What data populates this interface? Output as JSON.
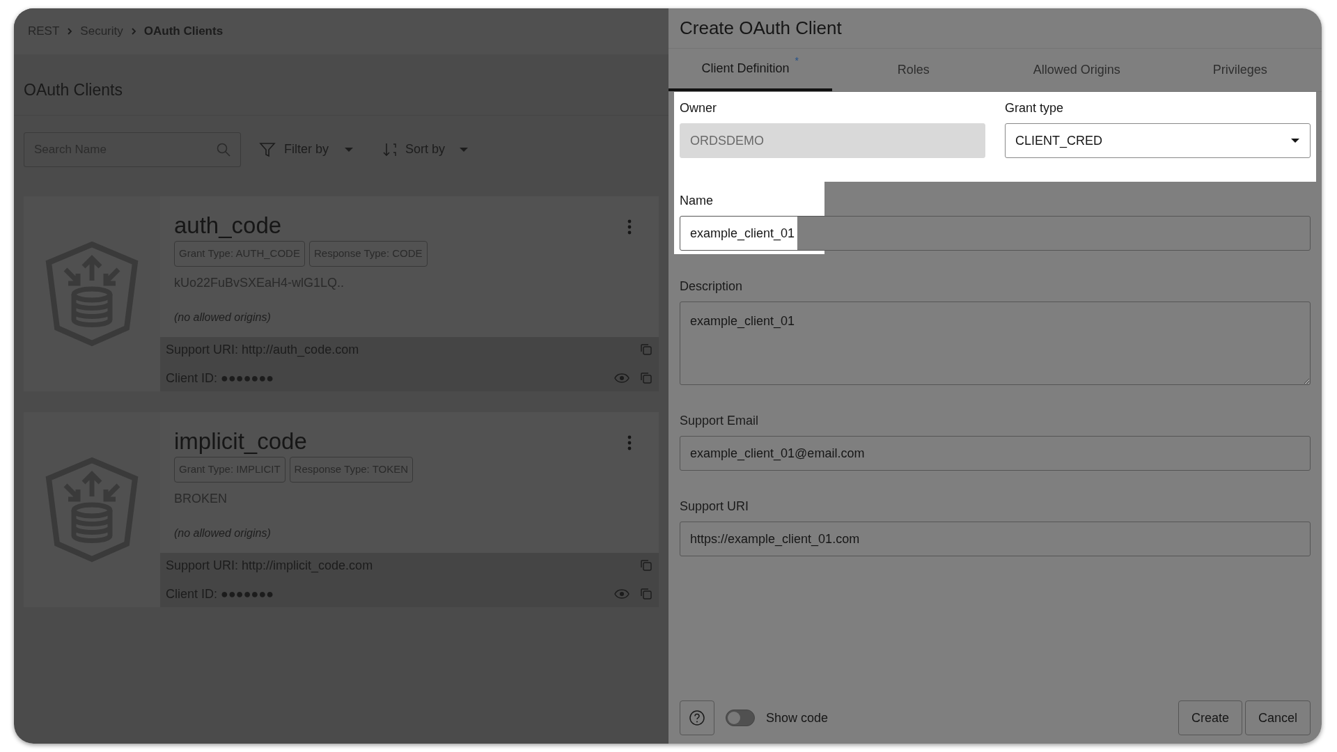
{
  "breadcrumb": [
    {
      "label": "REST",
      "current": false
    },
    {
      "label": "Security",
      "current": false
    },
    {
      "label": "OAuth Clients",
      "current": true
    }
  ],
  "list_panel": {
    "title": "OAuth Clients",
    "search": {
      "placeholder": "Search Name"
    },
    "filter": "Filter by",
    "sort": "Sort by"
  },
  "clients": [
    {
      "name": "auth_code",
      "tags": [
        "Grant Type: AUTH_CODE",
        "Response Type: CODE"
      ],
      "description": "kUo22FuBvSXEaH4-wlG1LQ..",
      "origins": "(no allowed origins)",
      "support_uri": "Support URI: http://auth_code.com",
      "client_id": "Client ID: ●●●●●●●"
    },
    {
      "name": "implicit_code",
      "tags": [
        "Grant Type: IMPLICIT",
        "Response Type: TOKEN"
      ],
      "description": "BROKEN",
      "origins": "(no allowed origins)",
      "support_uri": "Support URI: http://implicit_code.com",
      "client_id": "Client ID: ●●●●●●●"
    }
  ],
  "dialog": {
    "title": "Create OAuth Client",
    "tabs": [
      {
        "label": "Client Definition",
        "marker": "*",
        "selected": true
      },
      {
        "label": "Roles",
        "selected": false
      },
      {
        "label": "Allowed Origins",
        "selected": false
      },
      {
        "label": "Privileges",
        "selected": false
      }
    ],
    "rows": [
      {
        "highlighted": true,
        "fields": [
          {
            "kind": "text",
            "label": "Owner",
            "value": "ORDSDEMO",
            "disabled": true,
            "highlighted": false
          },
          {
            "kind": "select",
            "label": "Grant type",
            "value": "CLIENT_CRED",
            "disabled": false,
            "highlighted": false
          }
        ]
      },
      {
        "highlighted": false,
        "fields": [
          {
            "kind": "text",
            "label": "Name",
            "value": "example_client_01",
            "disabled": false,
            "highlighted": true
          }
        ]
      },
      {
        "highlighted": false,
        "fields": [
          {
            "kind": "textarea",
            "label": "Description",
            "value": "example_client_01",
            "disabled": false,
            "highlighted": false
          }
        ]
      },
      {
        "highlighted": false,
        "fields": [
          {
            "kind": "text",
            "label": "Support Email",
            "value": "example_client_01@email.com",
            "disabled": false,
            "highlighted": false
          }
        ]
      },
      {
        "highlighted": false,
        "fields": [
          {
            "kind": "text",
            "label": "Support URI",
            "value": "https://example_client_01.com",
            "disabled": false,
            "highlighted": false
          }
        ]
      }
    ],
    "show_code": {
      "label": "Show code",
      "on": false
    },
    "buttons": [
      "Create",
      "Cancel"
    ]
  }
}
